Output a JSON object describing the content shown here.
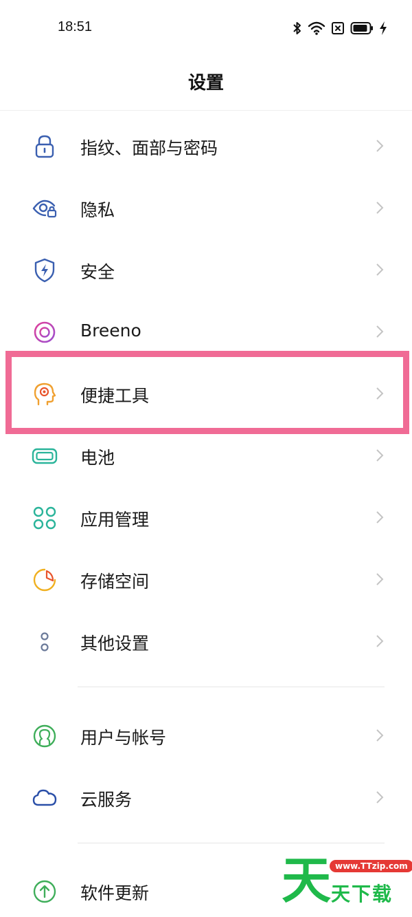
{
  "status_bar": {
    "time": "18:51",
    "icons": [
      "bluetooth-icon",
      "wifi-icon",
      "sim-off-icon",
      "battery-icon",
      "charging-icon"
    ]
  },
  "header": {
    "title": "设置"
  },
  "settings": {
    "items": [
      {
        "label": "指纹、面部与密码",
        "icon": "lock-icon",
        "color": "#3a5fb0"
      },
      {
        "label": "隐私",
        "icon": "privacy-eye-icon",
        "color": "#3a5fb0"
      },
      {
        "label": "安全",
        "icon": "shield-icon",
        "color": "#3a5fb0"
      },
      {
        "label": "Breeno",
        "icon": "breeno-icon",
        "color": "#c2409b"
      },
      {
        "label": "便捷工具",
        "icon": "head-target-icon",
        "color": "#f0a030"
      },
      {
        "label": "电池",
        "icon": "battery-setting-icon",
        "color": "#2ab49a"
      },
      {
        "label": "应用管理",
        "icon": "apps-grid-icon",
        "color": "#2ab49a"
      },
      {
        "label": "存储空间",
        "icon": "storage-pie-icon",
        "color": "#f0b020"
      },
      {
        "label": "其他设置",
        "icon": "more-dots-icon",
        "color": "#6b7a99"
      },
      {
        "label": "用户与帐号",
        "icon": "user-account-icon",
        "color": "#3fae5a"
      },
      {
        "label": "云服务",
        "icon": "cloud-icon",
        "color": "#2a4fa8"
      },
      {
        "label": "软件更新",
        "icon": "update-arrow-icon",
        "color": "#3fae5a"
      }
    ]
  },
  "highlight": {
    "target": "便捷工具",
    "color": "#f06b95"
  },
  "watermark": {
    "big_char": "天",
    "url": "www.TTzip.com",
    "sub": "天下载"
  }
}
